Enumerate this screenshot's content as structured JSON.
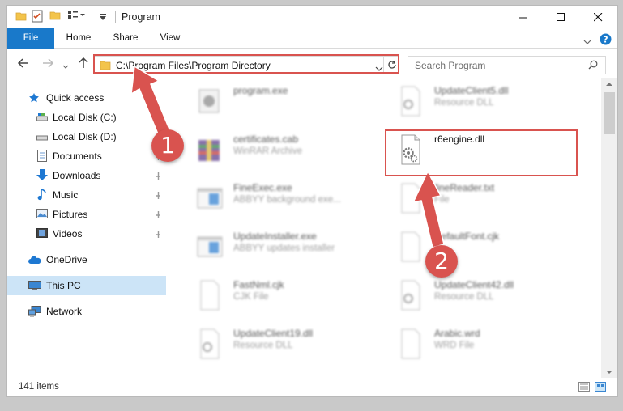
{
  "window": {
    "title": "Program",
    "minimize_icon": "minimize-icon",
    "maximize_icon": "maximize-icon",
    "close_icon": "close-icon"
  },
  "ribbon": {
    "tabs": [
      "File",
      "Home",
      "Share",
      "View"
    ],
    "accent": "#1979ca"
  },
  "address": {
    "path": "C:\\Program Files\\Program Directory",
    "search_placeholder": "Search Program"
  },
  "nav": {
    "items": [
      {
        "label": "Quick access",
        "icon": "star-icon"
      },
      {
        "label": "Local Disk (C:)",
        "icon": "drive-icon"
      },
      {
        "label": "Local Disk (D:)",
        "icon": "drive-icon"
      },
      {
        "label": "Documents",
        "icon": "documents-icon"
      },
      {
        "label": "Downloads",
        "icon": "downloads-icon"
      },
      {
        "label": "Music",
        "icon": "music-icon"
      },
      {
        "label": "Pictures",
        "icon": "pictures-icon"
      },
      {
        "label": "Videos",
        "icon": "videos-icon"
      },
      {
        "label": "OneDrive",
        "icon": "cloud-icon"
      },
      {
        "label": "This PC",
        "icon": "computer-icon",
        "selected": true
      },
      {
        "label": "Network",
        "icon": "network-icon"
      }
    ]
  },
  "files": [
    {
      "name": "program.exe",
      "type": ""
    },
    {
      "name": "UpdateClient5.dll",
      "type": "Resource DLL"
    },
    {
      "name": "certificates.cab",
      "type": "WinRAR Archive"
    },
    {
      "name": "r6engine.dll",
      "type": ""
    },
    {
      "name": "FineExec.exe",
      "type": "ABBYY background exe..."
    },
    {
      "name": "fineReader.txt",
      "type": "File"
    },
    {
      "name": "UpdateInstaller.exe",
      "type": "ABBYY updates installer"
    },
    {
      "name": "DefaultFont.cjk",
      "type": ""
    },
    {
      "name": "FastNml.cjk",
      "type": "CJK File"
    },
    {
      "name": "UpdateClient42.dll",
      "type": "Resource DLL"
    },
    {
      "name": "UpdateClient19.dll",
      "type": "Resource DLL"
    },
    {
      "name": "Arabic.wrd",
      "type": "WRD File"
    }
  ],
  "status": {
    "count": "141 items"
  },
  "annotations": {
    "step1": "1",
    "step2": "2",
    "color": "#d9534f"
  }
}
